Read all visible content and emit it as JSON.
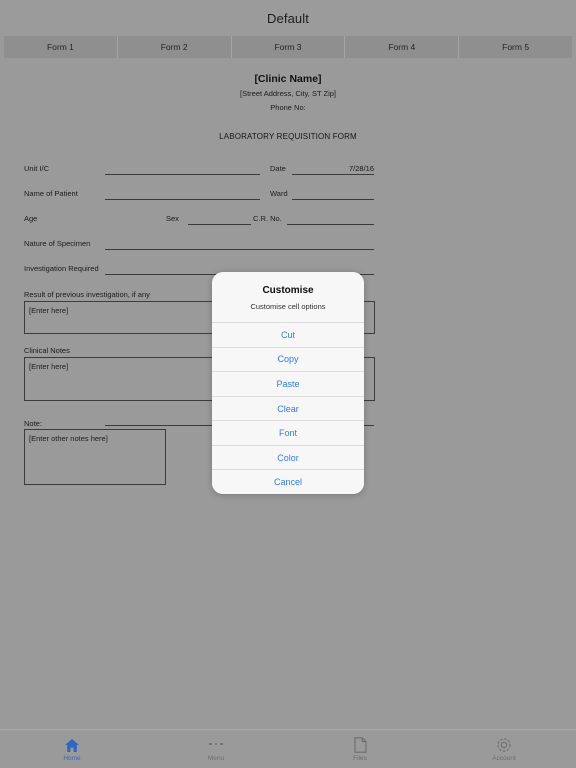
{
  "nav": {
    "title": "Default"
  },
  "form_tabs": [
    {
      "label": "Form 1"
    },
    {
      "label": "Form 2"
    },
    {
      "label": "Form 3"
    },
    {
      "label": "Form 4"
    },
    {
      "label": "Form 5"
    }
  ],
  "document": {
    "clinic_name": "[Clinic Name]",
    "clinic_address": "[Street Address, City, ST Zip]",
    "clinic_phone": "Phone No:",
    "title": "LABORATORY REQUISITION FORM",
    "fields": {
      "unit_ic_label": "Unit I/C",
      "date_label": "Date",
      "date_value": "7/28/16",
      "name_of_patient_label": "Name of Patient",
      "ward_label": "Ward",
      "age_label": "Age",
      "sex_label": "Sex",
      "cr_no_label": "C.R. No.",
      "nature_of_specimen_label": "Nature of Specimen",
      "investigation_required_label": "Investigation Required"
    },
    "blocks": {
      "previous_result_label": "Result of previous investigation, if any",
      "previous_result_value": "[Enter here]",
      "clinical_notes_label": "Clinical Notes",
      "clinical_notes_value": "[Enter here]",
      "note_label": "Note:",
      "note_value": "[Enter other notes here]"
    }
  },
  "alert": {
    "title": "Customise",
    "subtitle": "Customise cell options",
    "buttons": [
      {
        "label": "Cut"
      },
      {
        "label": "Copy"
      },
      {
        "label": "Paste"
      },
      {
        "label": "Clear"
      },
      {
        "label": "Font"
      },
      {
        "label": "Color"
      },
      {
        "label": "Cancel"
      }
    ]
  },
  "tabbar": {
    "items": [
      {
        "label": "Home",
        "icon": "home-icon"
      },
      {
        "label": "Menu",
        "icon": "ellipsis-icon"
      },
      {
        "label": "Files",
        "icon": "document-icon"
      },
      {
        "label": "Account",
        "icon": "gear-icon"
      }
    ]
  },
  "colors": {
    "background": "#9a9a9a",
    "accent": "#2f7bf6",
    "active_tab": "#2f66c4"
  }
}
